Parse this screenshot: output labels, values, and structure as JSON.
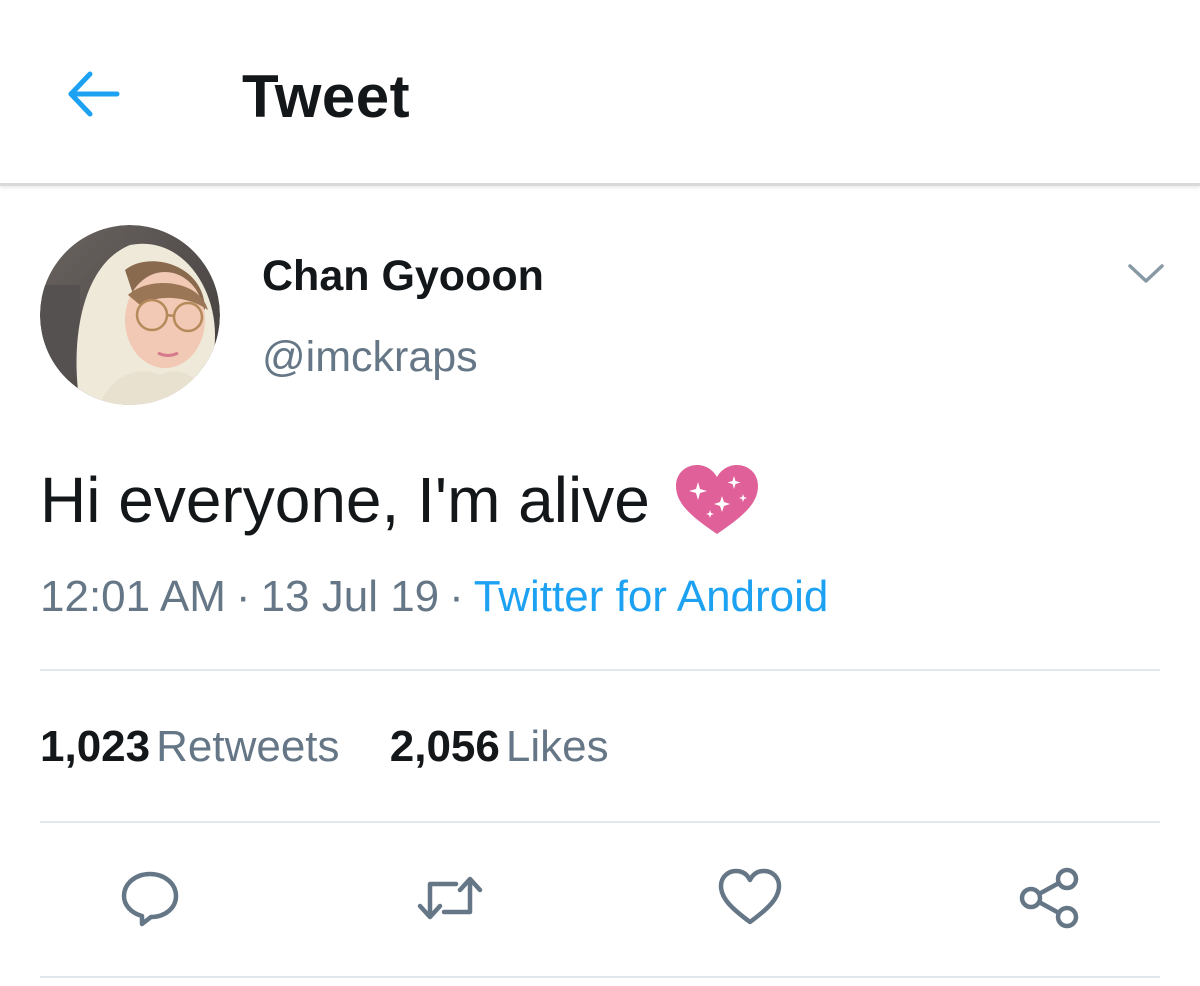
{
  "header": {
    "title": "Tweet",
    "back_icon": "arrow-left-icon"
  },
  "colors": {
    "accent": "#1da1f2",
    "text": "#14171a",
    "secondary_text": "#657786",
    "divider": "#e1e8ed",
    "emoji_heart": "#e0609a"
  },
  "tweet": {
    "author": {
      "display_name": "Chan Gyooon",
      "handle": "@imckraps"
    },
    "text": "Hi everyone, I'm alive",
    "emoji": "sparkling-heart",
    "time": "12:01 AM",
    "date": "13 Jul 19",
    "separator": "·",
    "source": "Twitter for Android",
    "stats": {
      "retweets_count": "1,023",
      "retweets_label": "Retweets",
      "likes_count": "2,056",
      "likes_label": "Likes"
    },
    "actions": [
      "reply-icon",
      "retweet-icon",
      "like-icon",
      "share-icon"
    ]
  }
}
